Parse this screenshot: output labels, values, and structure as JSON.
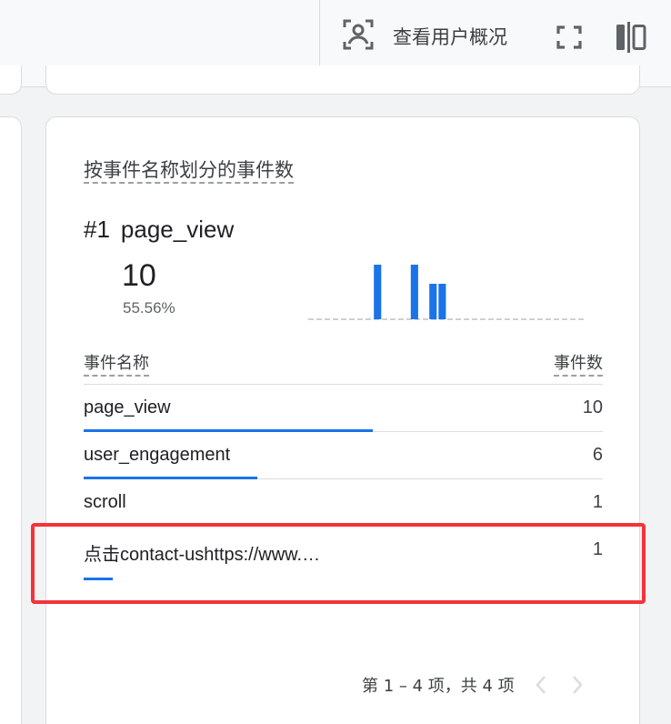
{
  "header": {
    "view_user_label": "查看用户概况",
    "icons": [
      "user-snapshot-icon",
      "fullscreen-icon",
      "split-view-icon"
    ]
  },
  "card": {
    "title": "按事件名称划分的事件数",
    "top_rank": "#1",
    "top_name": "page_view",
    "top_value": "10",
    "top_percent": "55.56%",
    "sparkline_values": [
      0,
      0,
      0,
      0,
      0,
      0,
      0,
      1,
      0,
      0,
      0,
      1,
      0,
      0.65,
      0.65,
      0,
      0,
      0,
      0,
      0,
      0,
      0,
      0,
      0,
      0,
      0,
      0,
      0,
      0,
      0
    ],
    "table": {
      "col_name": "事件名称",
      "col_count": "事件数",
      "rows": [
        {
          "name": "page_view",
          "count": "10",
          "share": 1.0
        },
        {
          "name": "user_engagement",
          "count": "6",
          "share": 0.6
        },
        {
          "name": "scroll",
          "count": "1",
          "share": 0.1
        },
        {
          "name": "点击contact-ushttps://www.…",
          "count": "1",
          "share": 0.1
        }
      ]
    },
    "pagination_text": "第 1 – 4 项，共 4 项"
  },
  "colors": {
    "accent": "#1a73e8",
    "highlight": "#f4333a",
    "border": "#dadce0"
  }
}
